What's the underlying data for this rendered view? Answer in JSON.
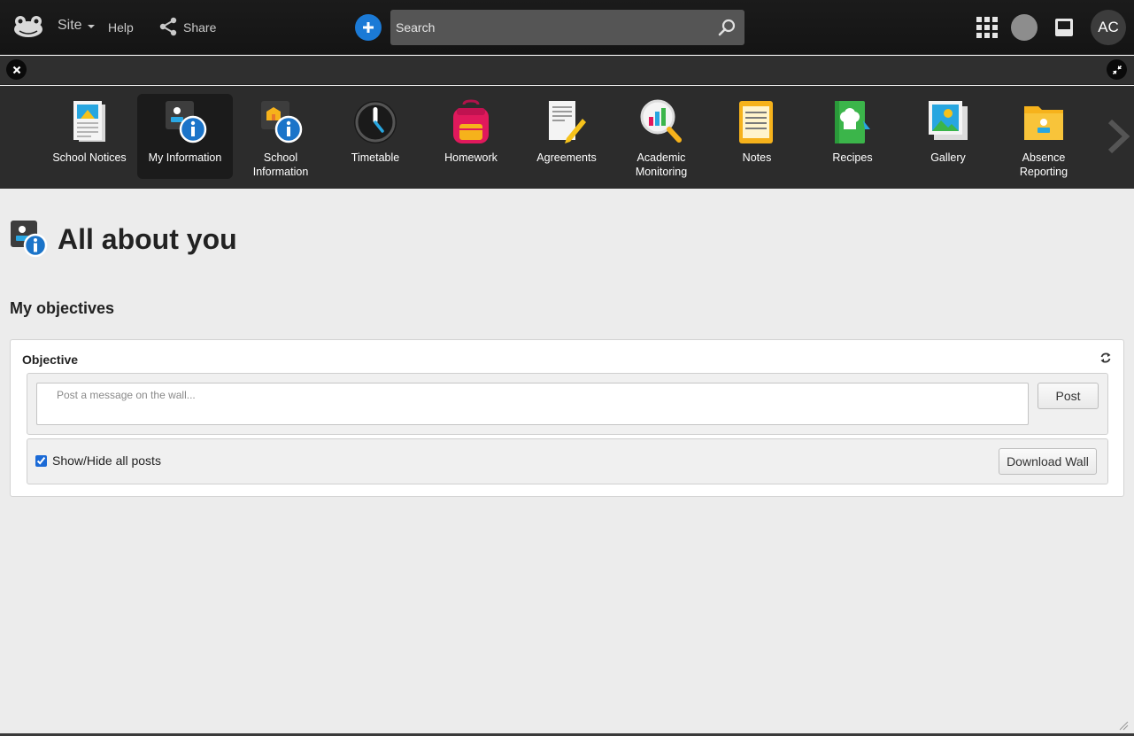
{
  "topbar": {
    "logo": "frog-logo",
    "site_label": "Site",
    "help_label": "Help",
    "share_label": "Share",
    "search_placeholder": "Search",
    "avatar_initials": "AC",
    "icons": [
      "add-icon",
      "search-icon",
      "apps-grid-icon",
      "status-icon",
      "inbox-icon"
    ]
  },
  "subbar": {
    "icons": [
      "close-icon",
      "collapse-icon"
    ]
  },
  "apps": [
    {
      "label": "School Notices",
      "icon": "newspaper-icon",
      "active": false
    },
    {
      "label": "My Information",
      "icon": "user-info-icon",
      "active": true
    },
    {
      "label": "School Information",
      "icon": "school-info-icon",
      "active": false
    },
    {
      "label": "Timetable",
      "icon": "clock-icon",
      "active": false
    },
    {
      "label": "Homework",
      "icon": "backpack-icon",
      "active": false
    },
    {
      "label": "Agreements",
      "icon": "document-pen-icon",
      "active": false
    },
    {
      "label": "Academic Monitoring",
      "icon": "magnifier-chart-icon",
      "active": false
    },
    {
      "label": "Notes",
      "icon": "notepad-icon",
      "active": false
    },
    {
      "label": "Recipes",
      "icon": "chef-book-icon",
      "active": false
    },
    {
      "label": "Gallery",
      "icon": "photo-icon",
      "active": false
    },
    {
      "label": "Absence Reporting",
      "icon": "folder-user-icon",
      "active": false
    }
  ],
  "page": {
    "title": "All about you",
    "section_heading": "My objectives"
  },
  "widget": {
    "title": "Objective",
    "post_placeholder": "Post a message on the wall...",
    "post_button": "Post",
    "show_hide_label": "Show/Hide all posts",
    "show_hide_checked": true,
    "download_button": "Download Wall"
  },
  "colors": {
    "topbar_bg": "#1b1b1b",
    "appstrip_bg": "#2c2c2c",
    "page_bg": "#ececec",
    "accent_blue": "#1b7ad6"
  }
}
